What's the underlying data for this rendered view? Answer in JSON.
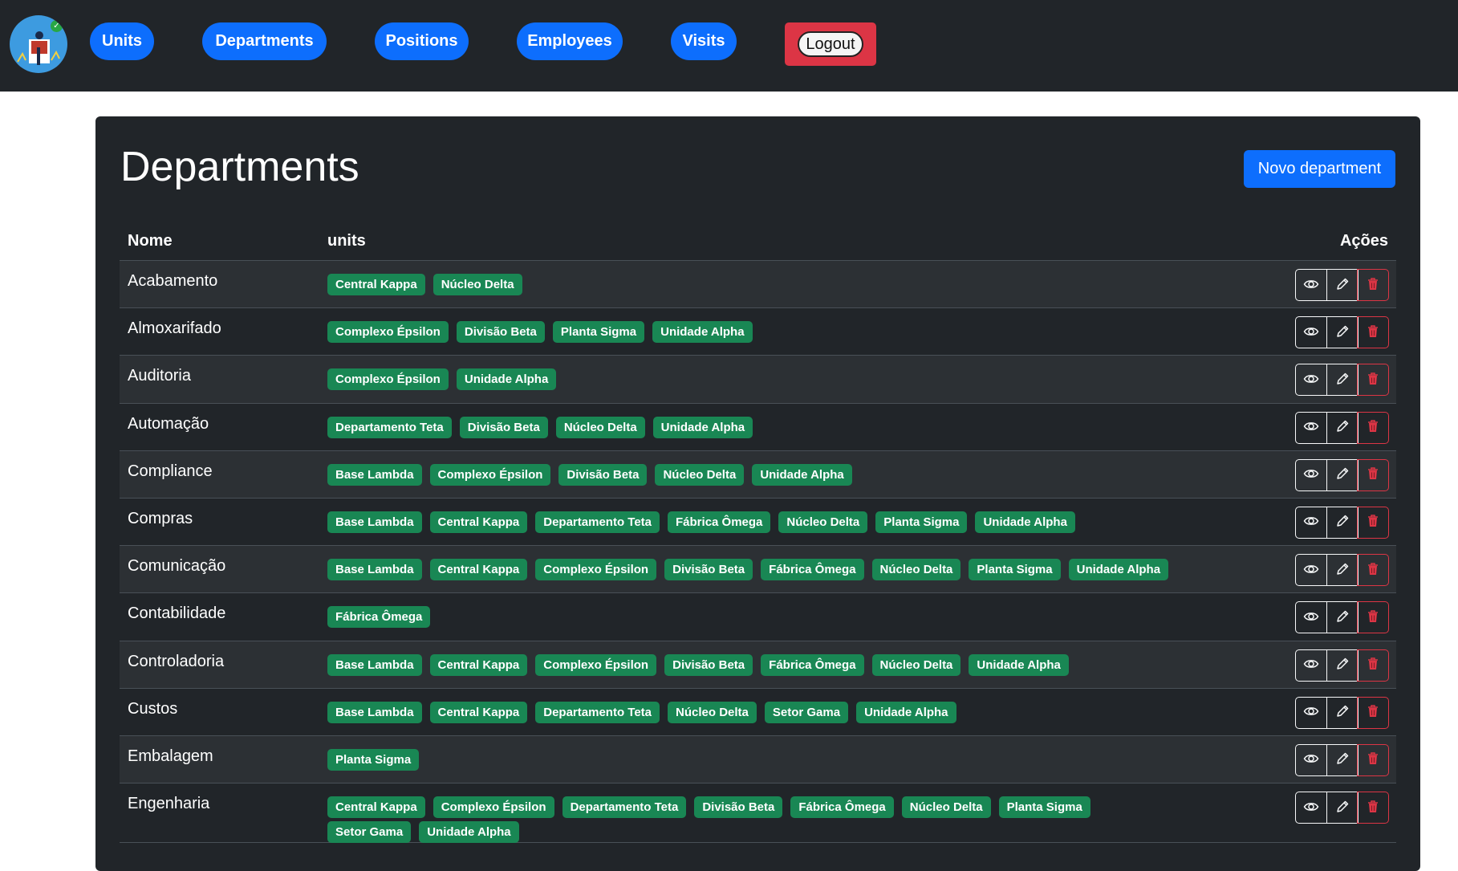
{
  "nav": {
    "items": [
      "Units",
      "Departments",
      "Positions",
      "Employees",
      "Visits"
    ],
    "logout_label": "Logout"
  },
  "page": {
    "title": "Departments",
    "new_button": "Novo department"
  },
  "table": {
    "headers": {
      "name": "Nome",
      "units": "units",
      "actions": "Ações"
    },
    "rows": [
      {
        "name": "Acabamento",
        "units": [
          "Central Kappa",
          "Núcleo Delta"
        ]
      },
      {
        "name": "Almoxarifado",
        "units": [
          "Complexo Épsilon",
          "Divisão Beta",
          "Planta Sigma",
          "Unidade Alpha"
        ]
      },
      {
        "name": "Auditoria",
        "units": [
          "Complexo Épsilon",
          "Unidade Alpha"
        ]
      },
      {
        "name": "Automação",
        "units": [
          "Departamento Teta",
          "Divisão Beta",
          "Núcleo Delta",
          "Unidade Alpha"
        ]
      },
      {
        "name": "Compliance",
        "units": [
          "Base Lambda",
          "Complexo Épsilon",
          "Divisão Beta",
          "Núcleo Delta",
          "Unidade Alpha"
        ]
      },
      {
        "name": "Compras",
        "units": [
          "Base Lambda",
          "Central Kappa",
          "Departamento Teta",
          "Fábrica Ômega",
          "Núcleo Delta",
          "Planta Sigma",
          "Unidade Alpha"
        ]
      },
      {
        "name": "Comunicação",
        "units": [
          "Base Lambda",
          "Central Kappa",
          "Complexo Épsilon",
          "Divisão Beta",
          "Fábrica Ômega",
          "Núcleo Delta",
          "Planta Sigma",
          "Unidade Alpha"
        ]
      },
      {
        "name": "Contabilidade",
        "units": [
          "Fábrica Ômega"
        ]
      },
      {
        "name": "Controladoria",
        "units": [
          "Base Lambda",
          "Central Kappa",
          "Complexo Épsilon",
          "Divisão Beta",
          "Fábrica Ômega",
          "Núcleo Delta",
          "Unidade Alpha"
        ]
      },
      {
        "name": "Custos",
        "units": [
          "Base Lambda",
          "Central Kappa",
          "Departamento Teta",
          "Núcleo Delta",
          "Setor Gama",
          "Unidade Alpha"
        ]
      },
      {
        "name": "Embalagem",
        "units": [
          "Planta Sigma"
        ]
      },
      {
        "name": "Engenharia",
        "units": [
          "Central Kappa",
          "Complexo Épsilon",
          "Departamento Teta",
          "Divisão Beta",
          "Fábrica Ômega",
          "Núcleo Delta",
          "Planta Sigma",
          "Setor Gama",
          "Unidade Alpha"
        ]
      }
    ]
  },
  "colors": {
    "accent": "#0d6efd",
    "badge": "#198754",
    "danger": "#dc3545",
    "dark": "#212529"
  }
}
